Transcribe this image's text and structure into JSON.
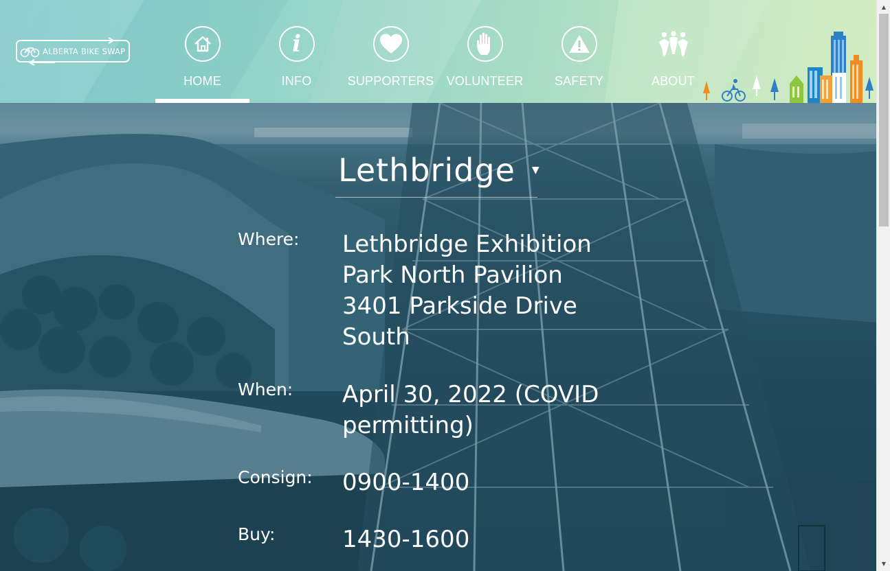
{
  "logo": {
    "text": "ALBERTA BIKE SWAP"
  },
  "nav": {
    "items": [
      {
        "label": "HOME",
        "icon": "home-icon",
        "active": true
      },
      {
        "label": "INFO",
        "icon": "info-icon",
        "active": false
      },
      {
        "label": "SUPPORTERS",
        "icon": "heart-icon",
        "active": false
      },
      {
        "label": "VOLUNTEER",
        "icon": "hand-icon",
        "active": false
      },
      {
        "label": "SAFETY",
        "icon": "warning-icon",
        "active": false
      },
      {
        "label": "ABOUT",
        "icon": "people-icon",
        "active": false
      }
    ]
  },
  "location": {
    "city": "Lethbridge",
    "caret": "▼"
  },
  "details": {
    "where_label": "Where:",
    "where_value": "Lethbridge Exhibition Park North Pavilion 3401 Parkside Drive South",
    "when_label": "When:",
    "when_value": "April 30, 2022 (COVID permitting)",
    "consign_label": "Consign:",
    "consign_value": "0900-1400",
    "buy_label": "Buy:",
    "buy_value": "1430-1600"
  },
  "colors": {
    "header_start": "#7cc7c7",
    "header_end": "#d4edc2",
    "text": "#ffffff",
    "hero_tint": "#24495b"
  }
}
